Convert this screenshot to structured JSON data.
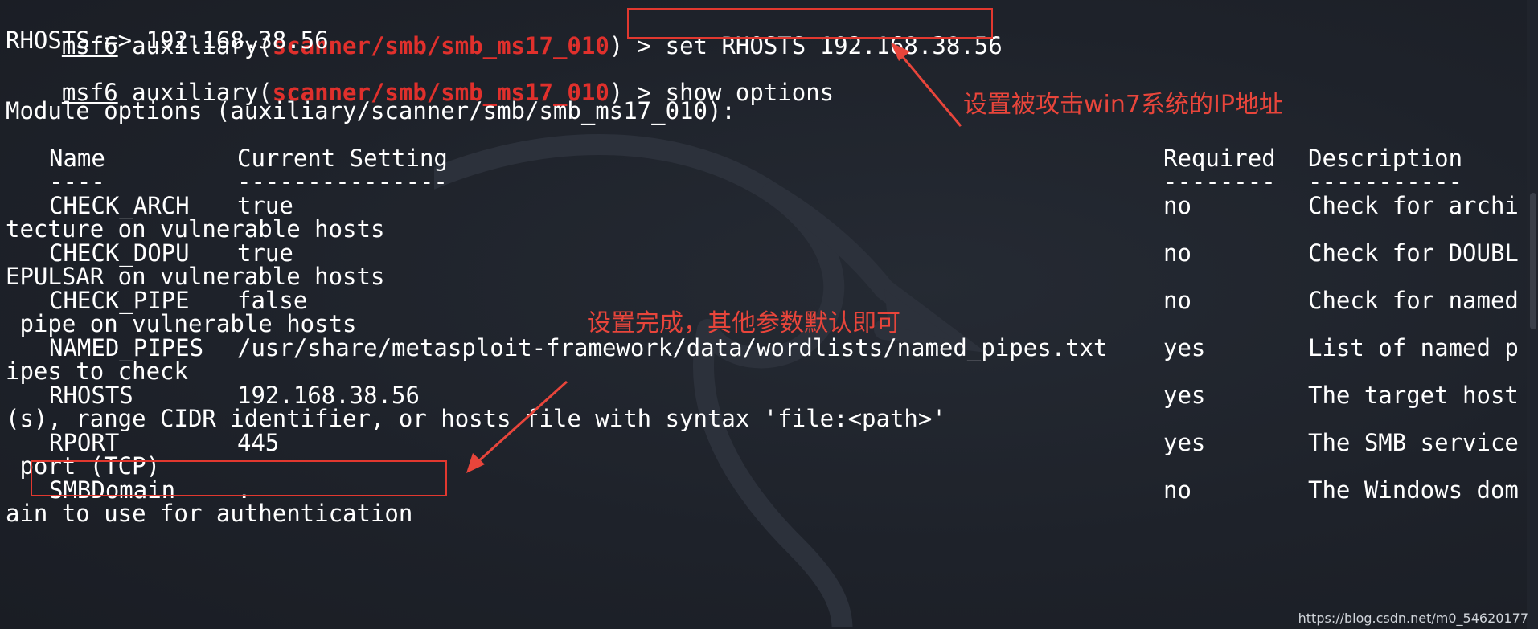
{
  "terminal": {
    "prompt": "msf6",
    "module_path": "scanner/smb/smb_ms17_010",
    "lines": {
      "cmd1_command": "set RHOSTS 192.168.38.56",
      "cmd1_output": "RHOSTS => 192.168.38.56",
      "cmd2_command": "show options",
      "module_options_header": "Module options (auxiliary/scanner/smb/smb_ms17_010):"
    },
    "table": {
      "headers": {
        "name": "Name",
        "setting": "Current Setting",
        "required": "Required",
        "description": "Description"
      },
      "separators": {
        "name": "----",
        "setting": "---------------",
        "required": "--------",
        "description": "-----------"
      },
      "rows": [
        {
          "name": "CHECK_ARCH",
          "setting": "true",
          "required": "no",
          "desc_start": "Check for archi",
          "desc_wrap": "tecture on vulnerable hosts"
        },
        {
          "name": "CHECK_DOPU",
          "setting": "true",
          "required": "no",
          "desc_start": "Check for DOUBL",
          "desc_wrap": "EPULSAR on vulnerable hosts"
        },
        {
          "name": "CHECK_PIPE",
          "setting": "false",
          "required": "no",
          "desc_start": "Check for named",
          "desc_wrap": " pipe on vulnerable hosts"
        },
        {
          "name": "NAMED_PIPES",
          "setting": "/usr/share/metasploit-framework/data/wordlists/named_pipes.txt",
          "required": "yes",
          "desc_start": "List of named p",
          "desc_wrap": "ipes to check"
        },
        {
          "name": "RHOSTS",
          "setting": "192.168.38.56",
          "required": "yes",
          "desc_start": "The target host",
          "desc_wrap": "(s), range CIDR identifier, or hosts file with syntax 'file:<path>'"
        },
        {
          "name": "RPORT",
          "setting": "445",
          "required": "yes",
          "desc_start": "The SMB service",
          "desc_wrap": " port (TCP)"
        },
        {
          "name": "SMBDomain",
          "setting": ".",
          "required": "no",
          "desc_start": "The Windows dom",
          "desc_wrap": "ain to use for authentication"
        }
      ]
    }
  },
  "annotations": {
    "ip_note": "设置被攻击win7系统的IP地址",
    "done_note": "设置完成，其他参数默认即可",
    "color": "#e8453b"
  },
  "credit": "https://blog.csdn.net/m0_54620177",
  "colors": {
    "background": "#1c2028",
    "text": "#ffffff",
    "module": "#e0302c"
  }
}
